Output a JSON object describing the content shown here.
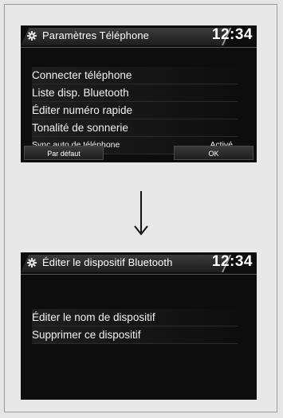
{
  "screen1": {
    "title": "Paramètres Téléphone",
    "clock": "12:34",
    "items": [
      "Connecter téléphone",
      "Liste disp. Bluetooth",
      "Éditer numéro rapide",
      "Tonalité de sonnerie"
    ],
    "setting": {
      "label": "Sync auto de téléphone",
      "value": "Activé"
    },
    "footer": {
      "left": "Par défaut",
      "right": "OK"
    }
  },
  "screen2": {
    "title": "Éditer le dispositif Bluetooth",
    "clock": "12:34",
    "items": [
      "Éditer le nom de dispositif",
      "Supprimer ce dispositif"
    ]
  },
  "icons": {
    "settings": "gear-icon",
    "transition": "arrow-down-icon"
  },
  "colors": {
    "screen_bg": "#0d0d0d",
    "text": "#ffffff",
    "page_bg": "#e6e6e6"
  }
}
